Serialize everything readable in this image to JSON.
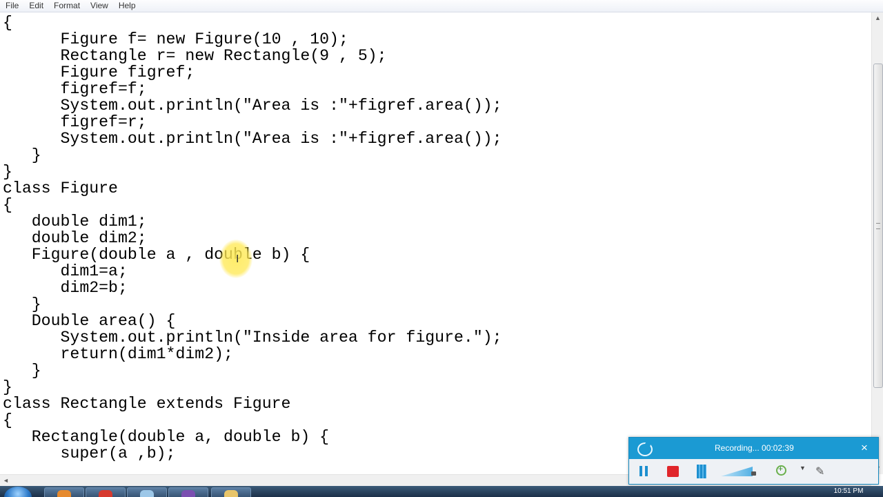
{
  "menu": [
    "File",
    "Edit",
    "Format",
    "View",
    "Help"
  ],
  "code_lines": [
    "{",
    "      Figure f= new Figure(10 , 10);",
    "      Rectangle r= new Rectangle(9 , 5);",
    "      Figure figref;",
    "      figref=f;",
    "      System.out.println(\"Area is :\"+figref.area());",
    "      figref=r;",
    "      System.out.println(\"Area is :\"+figref.area());",
    "   }",
    "}",
    "class Figure",
    "{",
    "   double dim1;",
    "   double dim2;",
    "   Figure(double a , double b) {",
    "      dim1=a;",
    "      dim2=b;",
    "   }",
    "   Double area() {",
    "      System.out.println(\"Inside area for figure.\");",
    "      return(dim1*dim2);",
    "   }",
    "}",
    "class Rectangle extends Figure",
    "{",
    "   Rectangle(double a, double b) {",
    "      super(a ,b);"
  ],
  "recorder": {
    "status": "Recording... 00:02:39",
    "close_icon": "×",
    "accent": "#1b9ad3"
  },
  "taskbar": {
    "clock": "10:51 PM"
  },
  "scrollbars": {
    "up": "▲",
    "down": "▼",
    "left": "◄",
    "right": "►"
  }
}
